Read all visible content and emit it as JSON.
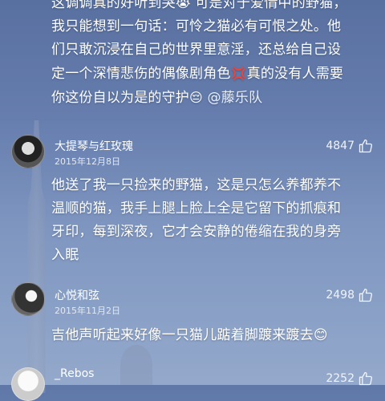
{
  "top_comment": {
    "lines": [
      "这调调真的好听到哭",
      "可是对于爱情中的野猫，",
      "我只能想到一句话：可怜之猫必有可恨之处。他",
      "们只敢沉浸在自己的世界里意淫，还总给自己设",
      "定一个深情悲伤的偶像剧角色",
      "真的没有人需要",
      "你这份自以为是的守护"
    ],
    "mention": "@藤乐队",
    "emoji_cry": "😭",
    "emoji_anger": "💢",
    "emoji_relieved": "😔"
  },
  "comments": [
    {
      "username": "大提琴与红玫瑰",
      "date": "2015年12月8日",
      "likes": "4847",
      "lines": [
        "他送了我一只捡来的野猫，这是只怎么养都养不",
        "温顺的猫，我手上腿上脸上全是它留下的抓痕和",
        "牙印，每到深夜，它才会安静的倦缩在我的身旁",
        "入眠"
      ]
    },
    {
      "username": "心悦和弦",
      "date": "2015年11月2日",
      "likes": "2498",
      "text": "吉他声听起来好像一只猫儿踮着脚踱来踱去",
      "emoji": "😊"
    },
    {
      "username": "_Rebos",
      "likes": "2252"
    }
  ],
  "icons": {
    "like": "thumbs-up-icon"
  }
}
